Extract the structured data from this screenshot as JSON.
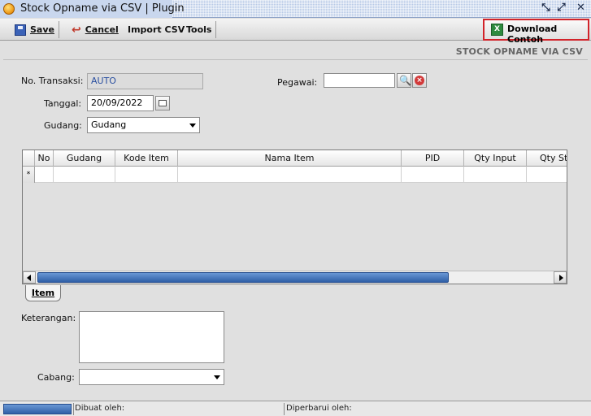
{
  "window": {
    "title": "Stock Opname via CSV | Plugin"
  },
  "toolbar": {
    "save_label": "Save",
    "cancel_label": "Cancel",
    "import_label": "Import CSV",
    "tools_label": "Tools",
    "download_label": "Download Contoh",
    "download_icon": "excel-icon"
  },
  "page": {
    "heading": "STOCK OPNAME VIA CSV"
  },
  "form": {
    "no_transaksi_label": "No. Transaksi:",
    "no_transaksi_value": "AUTO",
    "pegawai_label": "Pegawai:",
    "pegawai_value": "",
    "tanggal_label": "Tanggal:",
    "tanggal_value": "20/09/2022",
    "gudang_label": "Gudang:",
    "gudang_value": "Gudang",
    "keterangan_label": "Keterangan:",
    "keterangan_value": "",
    "cabang_label": "Cabang:",
    "cabang_value": ""
  },
  "grid": {
    "columns": [
      "No",
      "Gudang",
      "Kode Item",
      "Nama Item",
      "PID",
      "Qty Input",
      "Qty Sto"
    ],
    "new_row_marker": "*"
  },
  "tabs": [
    {
      "label": "Item",
      "active": true
    }
  ],
  "statusbar": {
    "created_label": "Dibuat oleh:",
    "updated_label": "Diperbarui oleh:"
  },
  "colors": {
    "highlight": "#d2232a",
    "accent": "#2f5fa7"
  }
}
